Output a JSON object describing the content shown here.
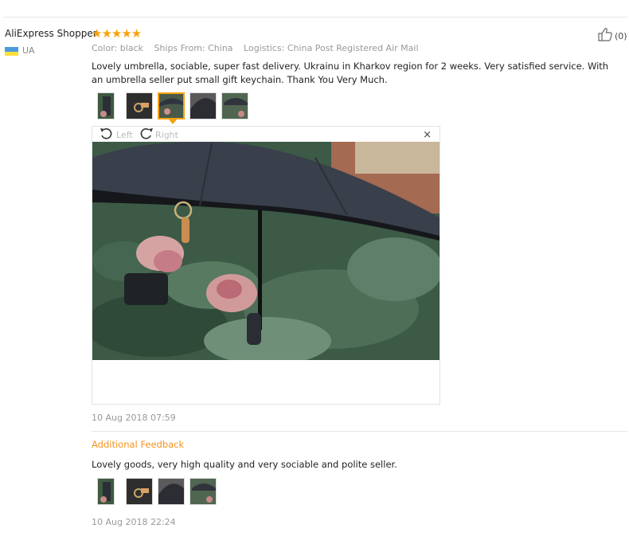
{
  "review": {
    "user_name": "AliExpress Shopper",
    "country": "UA",
    "rating_stars": "★★★★★",
    "rating": 5,
    "like_count": "(0)",
    "meta": {
      "color": "Color: black",
      "ships_from": "Ships From: China",
      "logistics": "Logistics: China Post Registered Air Mail"
    },
    "text": "Lovely umbrella, sociable, super fast delivery. Ukrainu in Kharkov region for 2 weeks. Very satisfied service. With an umbrella seller put small gift keychain. Thank You Very Much.",
    "viewer": {
      "rotate_left_label": "Left",
      "rotate_right_label": "Right",
      "close_symbol": "×"
    },
    "date": "10 Aug 2018 07:59",
    "additional_feedback_label": "Additional Feedback",
    "additional_text": "Lovely goods, very high quality and very sociable and polite seller.",
    "additional_date": "10 Aug 2018 22:24"
  },
  "colors": {
    "star": "#f7a20f",
    "accent": "#f7931e",
    "muted": "#999999"
  },
  "icons": [
    "thumbs-up-icon",
    "rotate-left-icon",
    "rotate-right-icon",
    "close-icon",
    "flag-icon"
  ]
}
